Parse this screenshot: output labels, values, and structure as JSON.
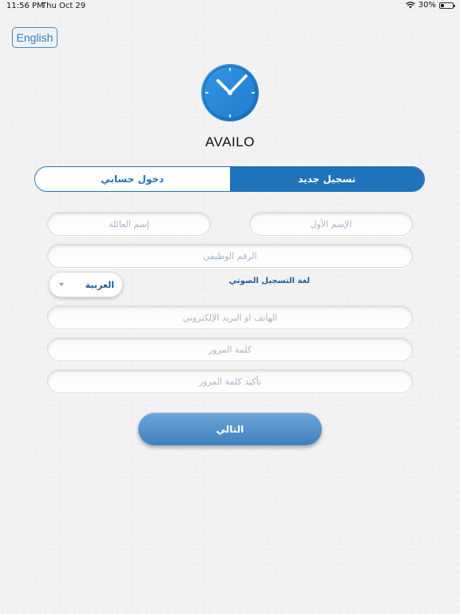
{
  "status_bar": {
    "time": "11:56 PM",
    "date": "Thu Oct 29",
    "battery": "30%",
    "battery_level": 0.3
  },
  "language_button": "English",
  "app": {
    "title": "AVAILO",
    "logo_icon": "clock-icon"
  },
  "tabs": {
    "login": "دخول حسابي",
    "register": "تسجيل جديد",
    "active": "register"
  },
  "form": {
    "first_name_placeholder": "الإسم الأول",
    "last_name_placeholder": "إسم العائلة",
    "job_number_placeholder": "الرقم الوظيفي",
    "voice_language_label": "لغة التسجيل الصوتي",
    "voice_language_value": "العربية",
    "phone_email_placeholder": "الهاتف او البريد الإلكتروني",
    "password_placeholder": "كلمة المرور",
    "confirm_password_placeholder": "تأكيد كلمة المرور"
  },
  "next_button": "التالي",
  "colors": {
    "primary": "#1f73ba",
    "button_gradient_top": "#6ea6d9",
    "button_gradient_bottom": "#3f80c0",
    "placeholder": "#a5b4c8"
  }
}
